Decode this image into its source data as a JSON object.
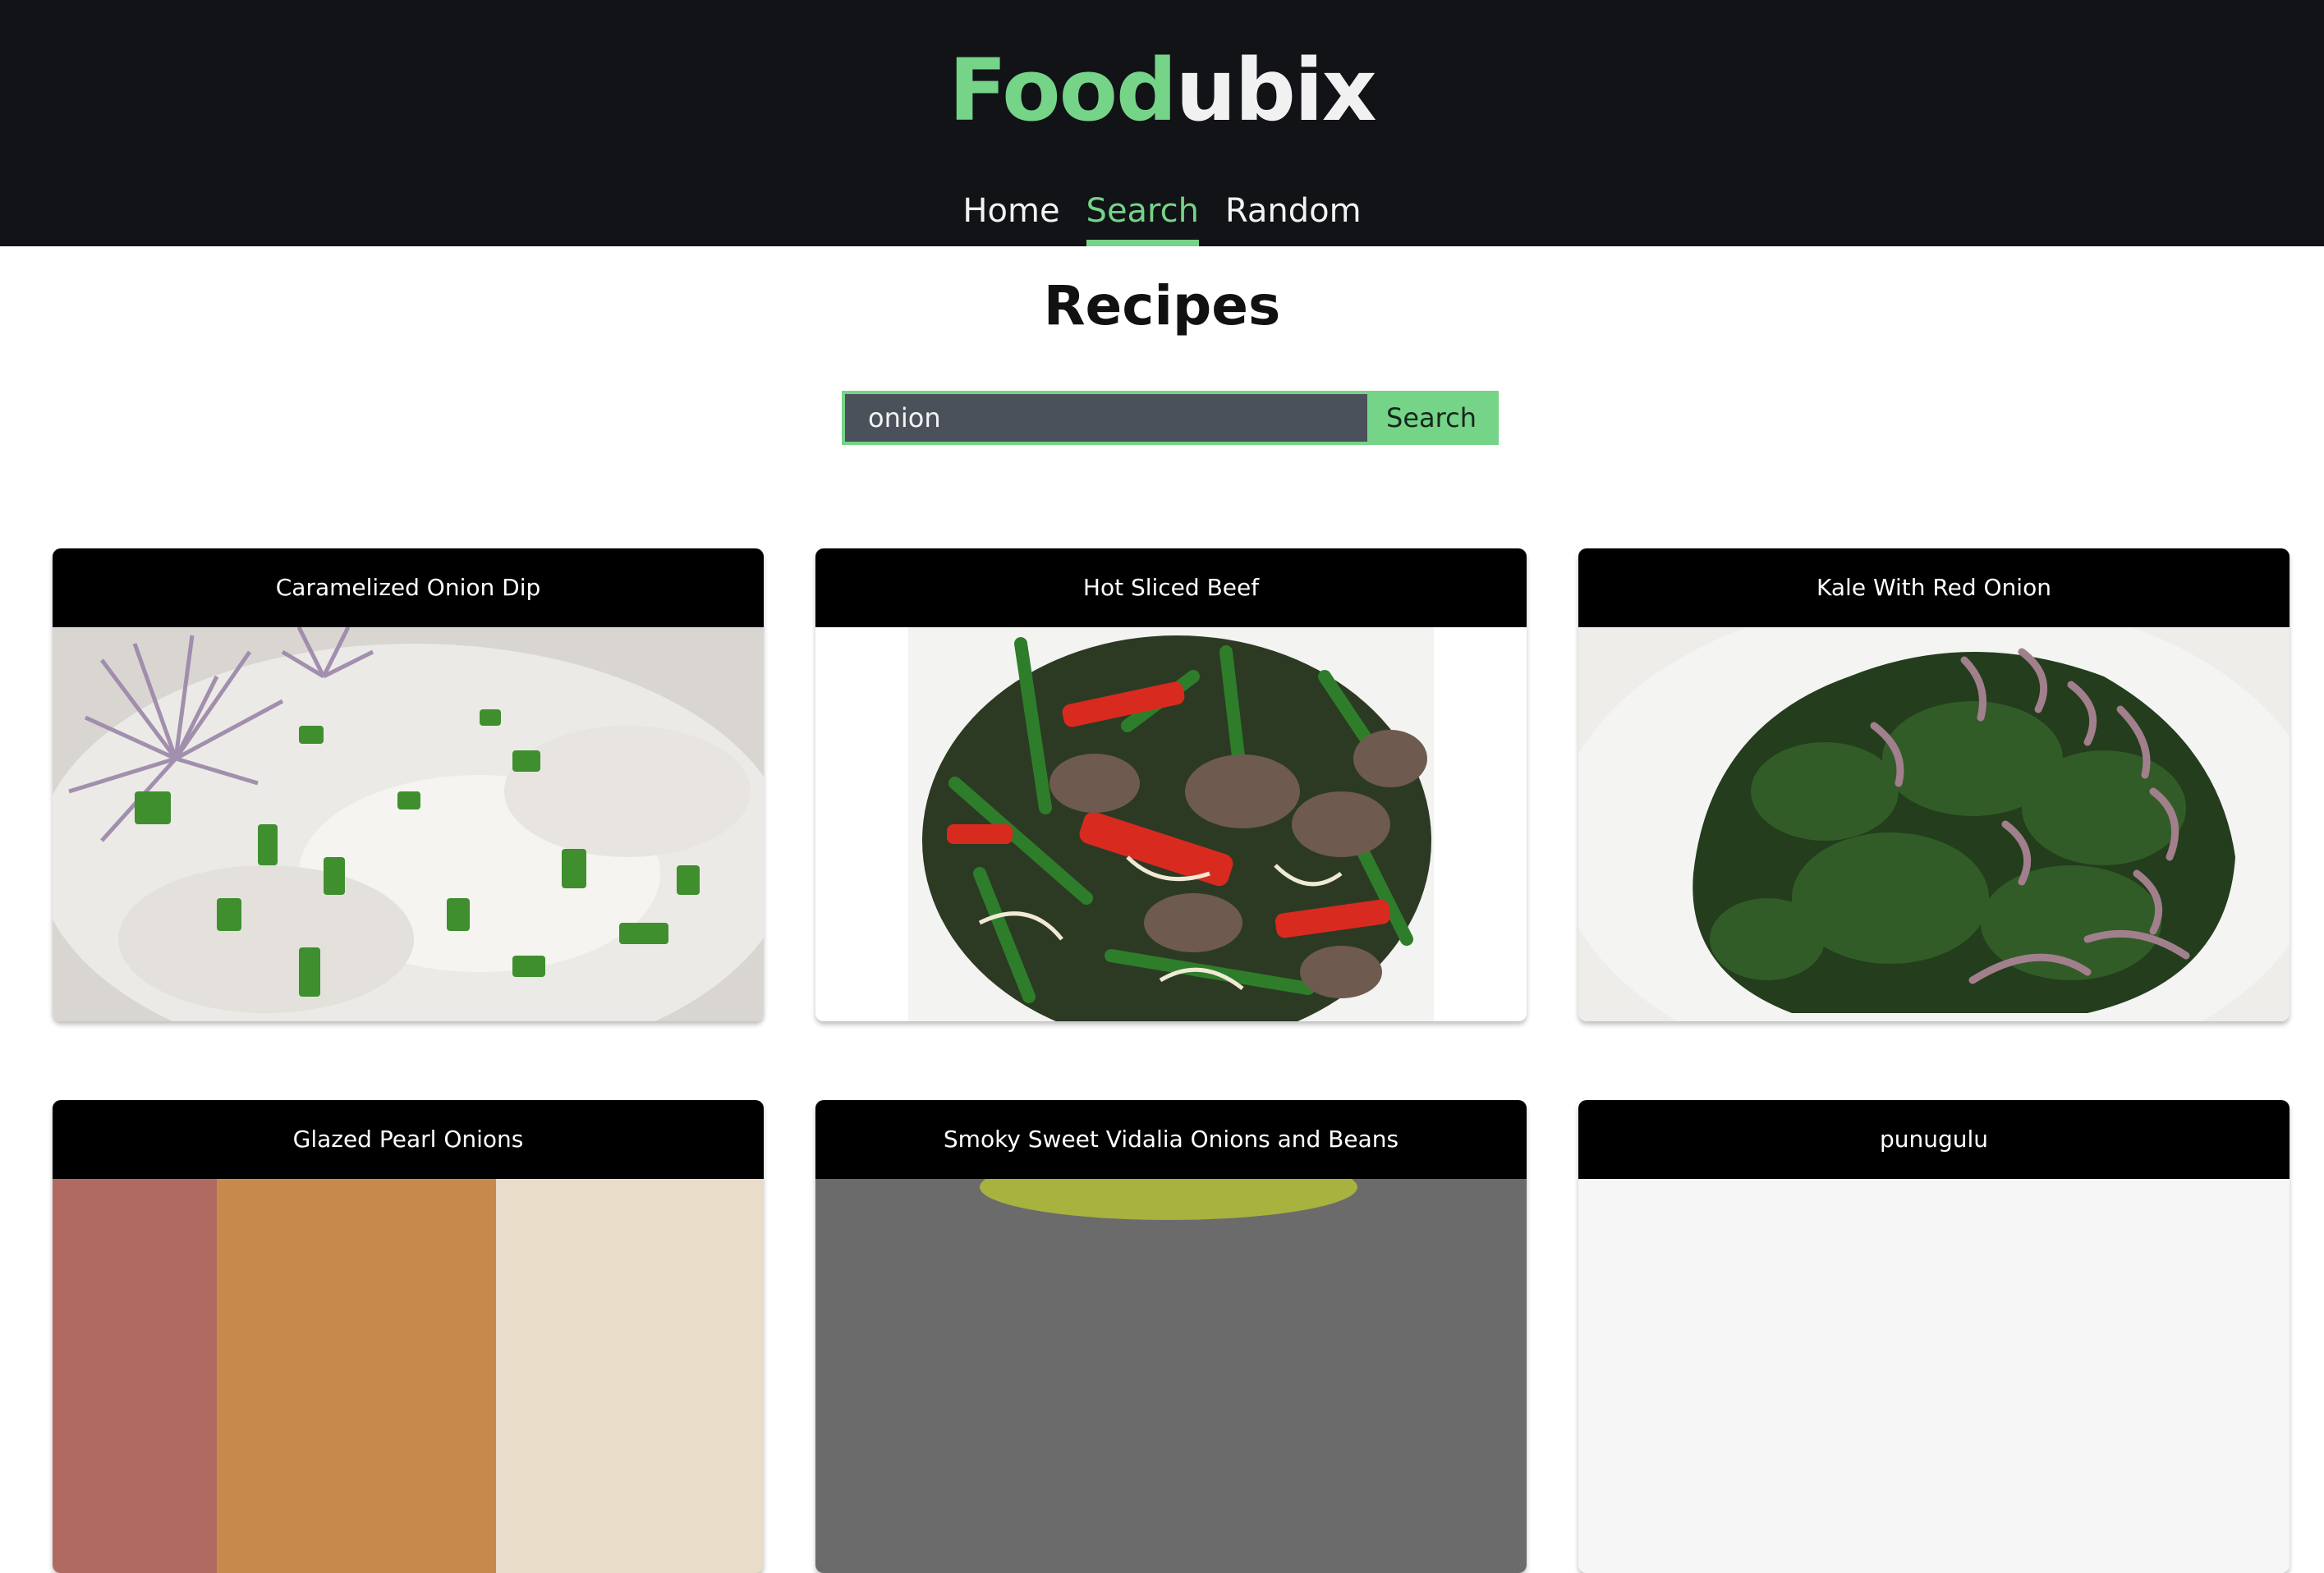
{
  "brand": {
    "part1": "Food",
    "part2": "ubix"
  },
  "nav": {
    "items": [
      {
        "label": "Home",
        "active": false
      },
      {
        "label": "Search",
        "active": true
      },
      {
        "label": "Random",
        "active": false
      }
    ]
  },
  "page": {
    "title": "Recipes"
  },
  "search": {
    "value": "onion",
    "button_label": "Search"
  },
  "recipes": [
    {
      "title": "Caramelized Onion Dip"
    },
    {
      "title": "Hot Sliced Beef"
    },
    {
      "title": "Kale With Red Onion"
    },
    {
      "title": "Glazed Pearl Onions"
    },
    {
      "title": "Smoky Sweet Vidalia Onions and Beans"
    },
    {
      "title": "punugulu"
    }
  ],
  "colors": {
    "accent": "#75d487",
    "header_bg": "#111317",
    "card_title_bg": "#000000",
    "input_bg": "#4b515b"
  }
}
